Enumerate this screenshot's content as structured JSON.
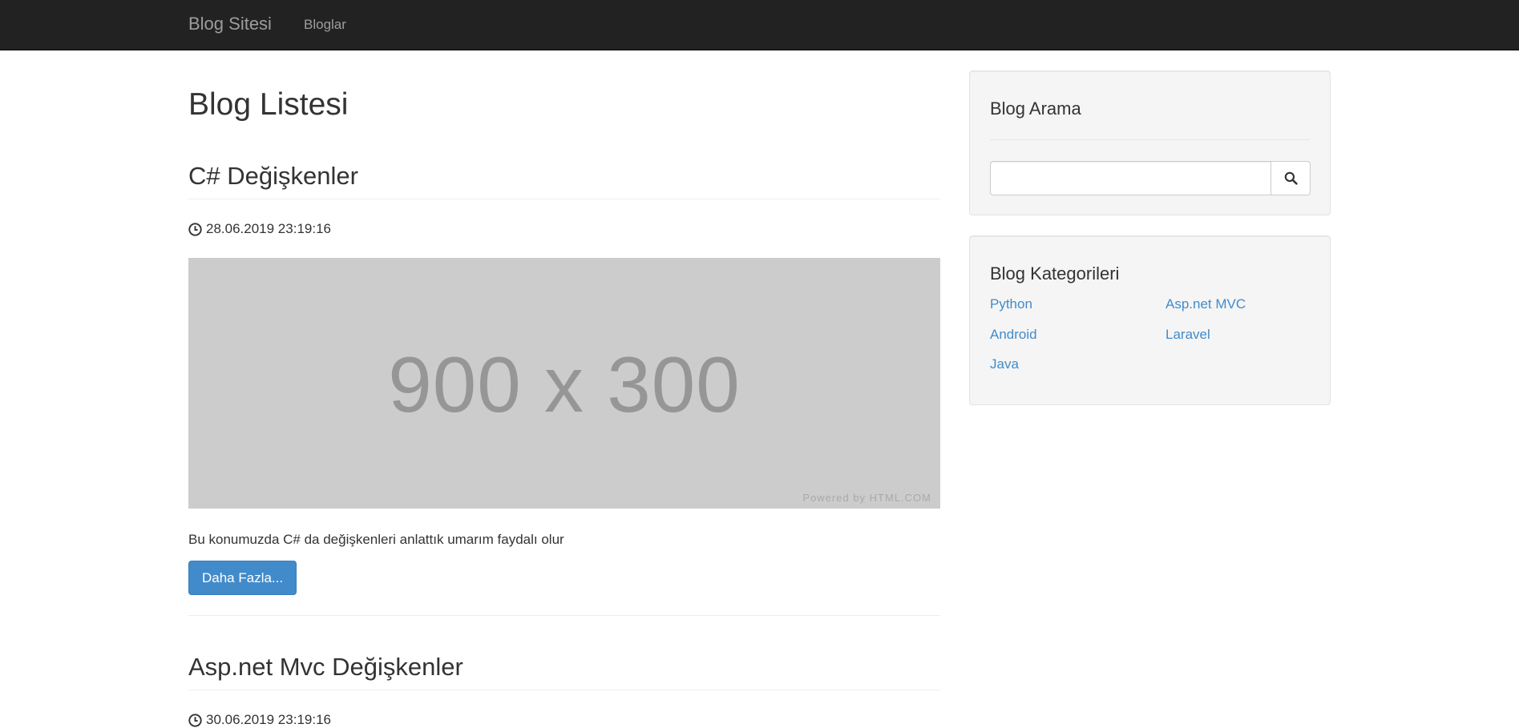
{
  "navbar": {
    "brand": "Blog Sitesi",
    "links": [
      {
        "label": "Bloglar"
      }
    ]
  },
  "main": {
    "title": "Blog Listesi",
    "posts": [
      {
        "title": "C# Değişkenler",
        "date": "28.06.2019 23:19:16",
        "image_text": "900 x 300",
        "image_credit": "Powered by HTML.COM",
        "summary": "Bu konumuzda C# da değişkenleri anlattık umarım faydalı olur",
        "button_label": "Daha Fazla..."
      },
      {
        "title": "Asp.net Mvc Değişkenler",
        "date": "30.06.2019 23:19:16"
      }
    ]
  },
  "sidebar": {
    "search": {
      "title": "Blog Arama",
      "input_value": "",
      "button_icon": "search-icon"
    },
    "categories": {
      "title": "Blog Kategorileri",
      "items": [
        "Python",
        "Asp.net MVC",
        "Android",
        "Laravel",
        "Java"
      ]
    }
  },
  "colors": {
    "navbar_bg": "#222222",
    "link": "#428bca",
    "primary_button": "#428bca",
    "well_bg": "#f5f5f5"
  }
}
